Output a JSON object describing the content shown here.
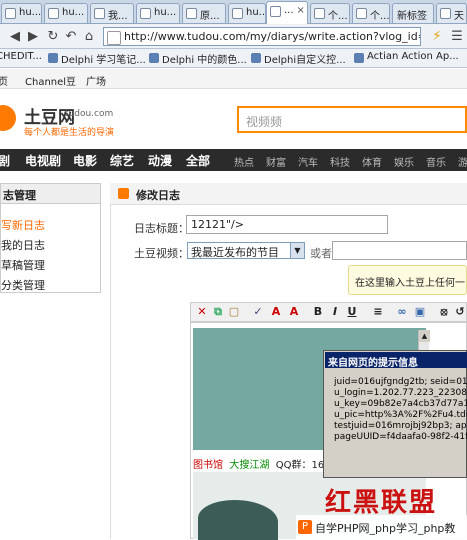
{
  "browser": {
    "tabs": [
      {
        "label": "hu..."
      },
      {
        "label": "hu..."
      },
      {
        "label": "我..."
      },
      {
        "label": "hu..."
      },
      {
        "label": "原..."
      },
      {
        "label": "hu..."
      },
      {
        "label": "..."
      },
      {
        "label": "个..."
      },
      {
        "label": "个..."
      },
      {
        "label": "新标签"
      },
      {
        "label": "天"
      }
    ],
    "tab_close": "×",
    "url": "http://www.tudou.com/my/diarys/write.action?vlog_id=1263",
    "bookmarks": [
      {
        "label": "CHEDIT..."
      },
      {
        "label": "Delphi 学习笔记..."
      },
      {
        "label": "Delphi 中的颜色..."
      },
      {
        "label": "Delphi自定义控..."
      },
      {
        "label": "Actian Action Ap..."
      }
    ]
  },
  "site": {
    "topnav": [
      "页",
      "Channel豆",
      "广场"
    ],
    "logo_text": "土豆网",
    "logo_domain": "tudou.com",
    "slogan": "每个人都是生活的导演",
    "search_placeholder": "视频频",
    "main_nav": [
      "剧",
      "电视剧",
      "电影",
      "综艺",
      "动漫",
      "全部"
    ],
    "sub_nav": [
      "热点",
      "财富",
      "汽车",
      "科技",
      "体育",
      "娱乐",
      "音乐",
      "游"
    ]
  },
  "sidebar": {
    "title": "志管理",
    "items": [
      {
        "label": "写新日志"
      },
      {
        "label": "我的日志"
      },
      {
        "label": "草稿管理"
      },
      {
        "label": "分类管理"
      }
    ]
  },
  "diary": {
    "section_title": "修改日志",
    "title_label": "日志标题：",
    "title_value": "12121\"/>",
    "video_label": "土豆视频：",
    "video_select": "我最近发布的节目",
    "or_label": "或者",
    "tip": "在这里输入土豆上任何一",
    "links": [
      "图书馆",
      "大搜江湖",
      "QQ群：162"
    ],
    "banner_text": "红黑联盟"
  },
  "alert": {
    "title": "来自网页的提示信息",
    "lines": [
      "juid=016ujfgndg2tb; seid=016uj",
      "u_login=1.202.77.223_22308938",
      "u_key=09b82e7a4cb37d77a1084",
      "u_pic=http%3A%2F%2Fu4.tdimg",
      "testjuid=016mrojbj92bp3; apyuid",
      "pageUUID=f4daafa0-98f2-41f1-9"
    ]
  },
  "watermark": {
    "icon": "P",
    "text": "自学PHP网_php学习_php教"
  }
}
